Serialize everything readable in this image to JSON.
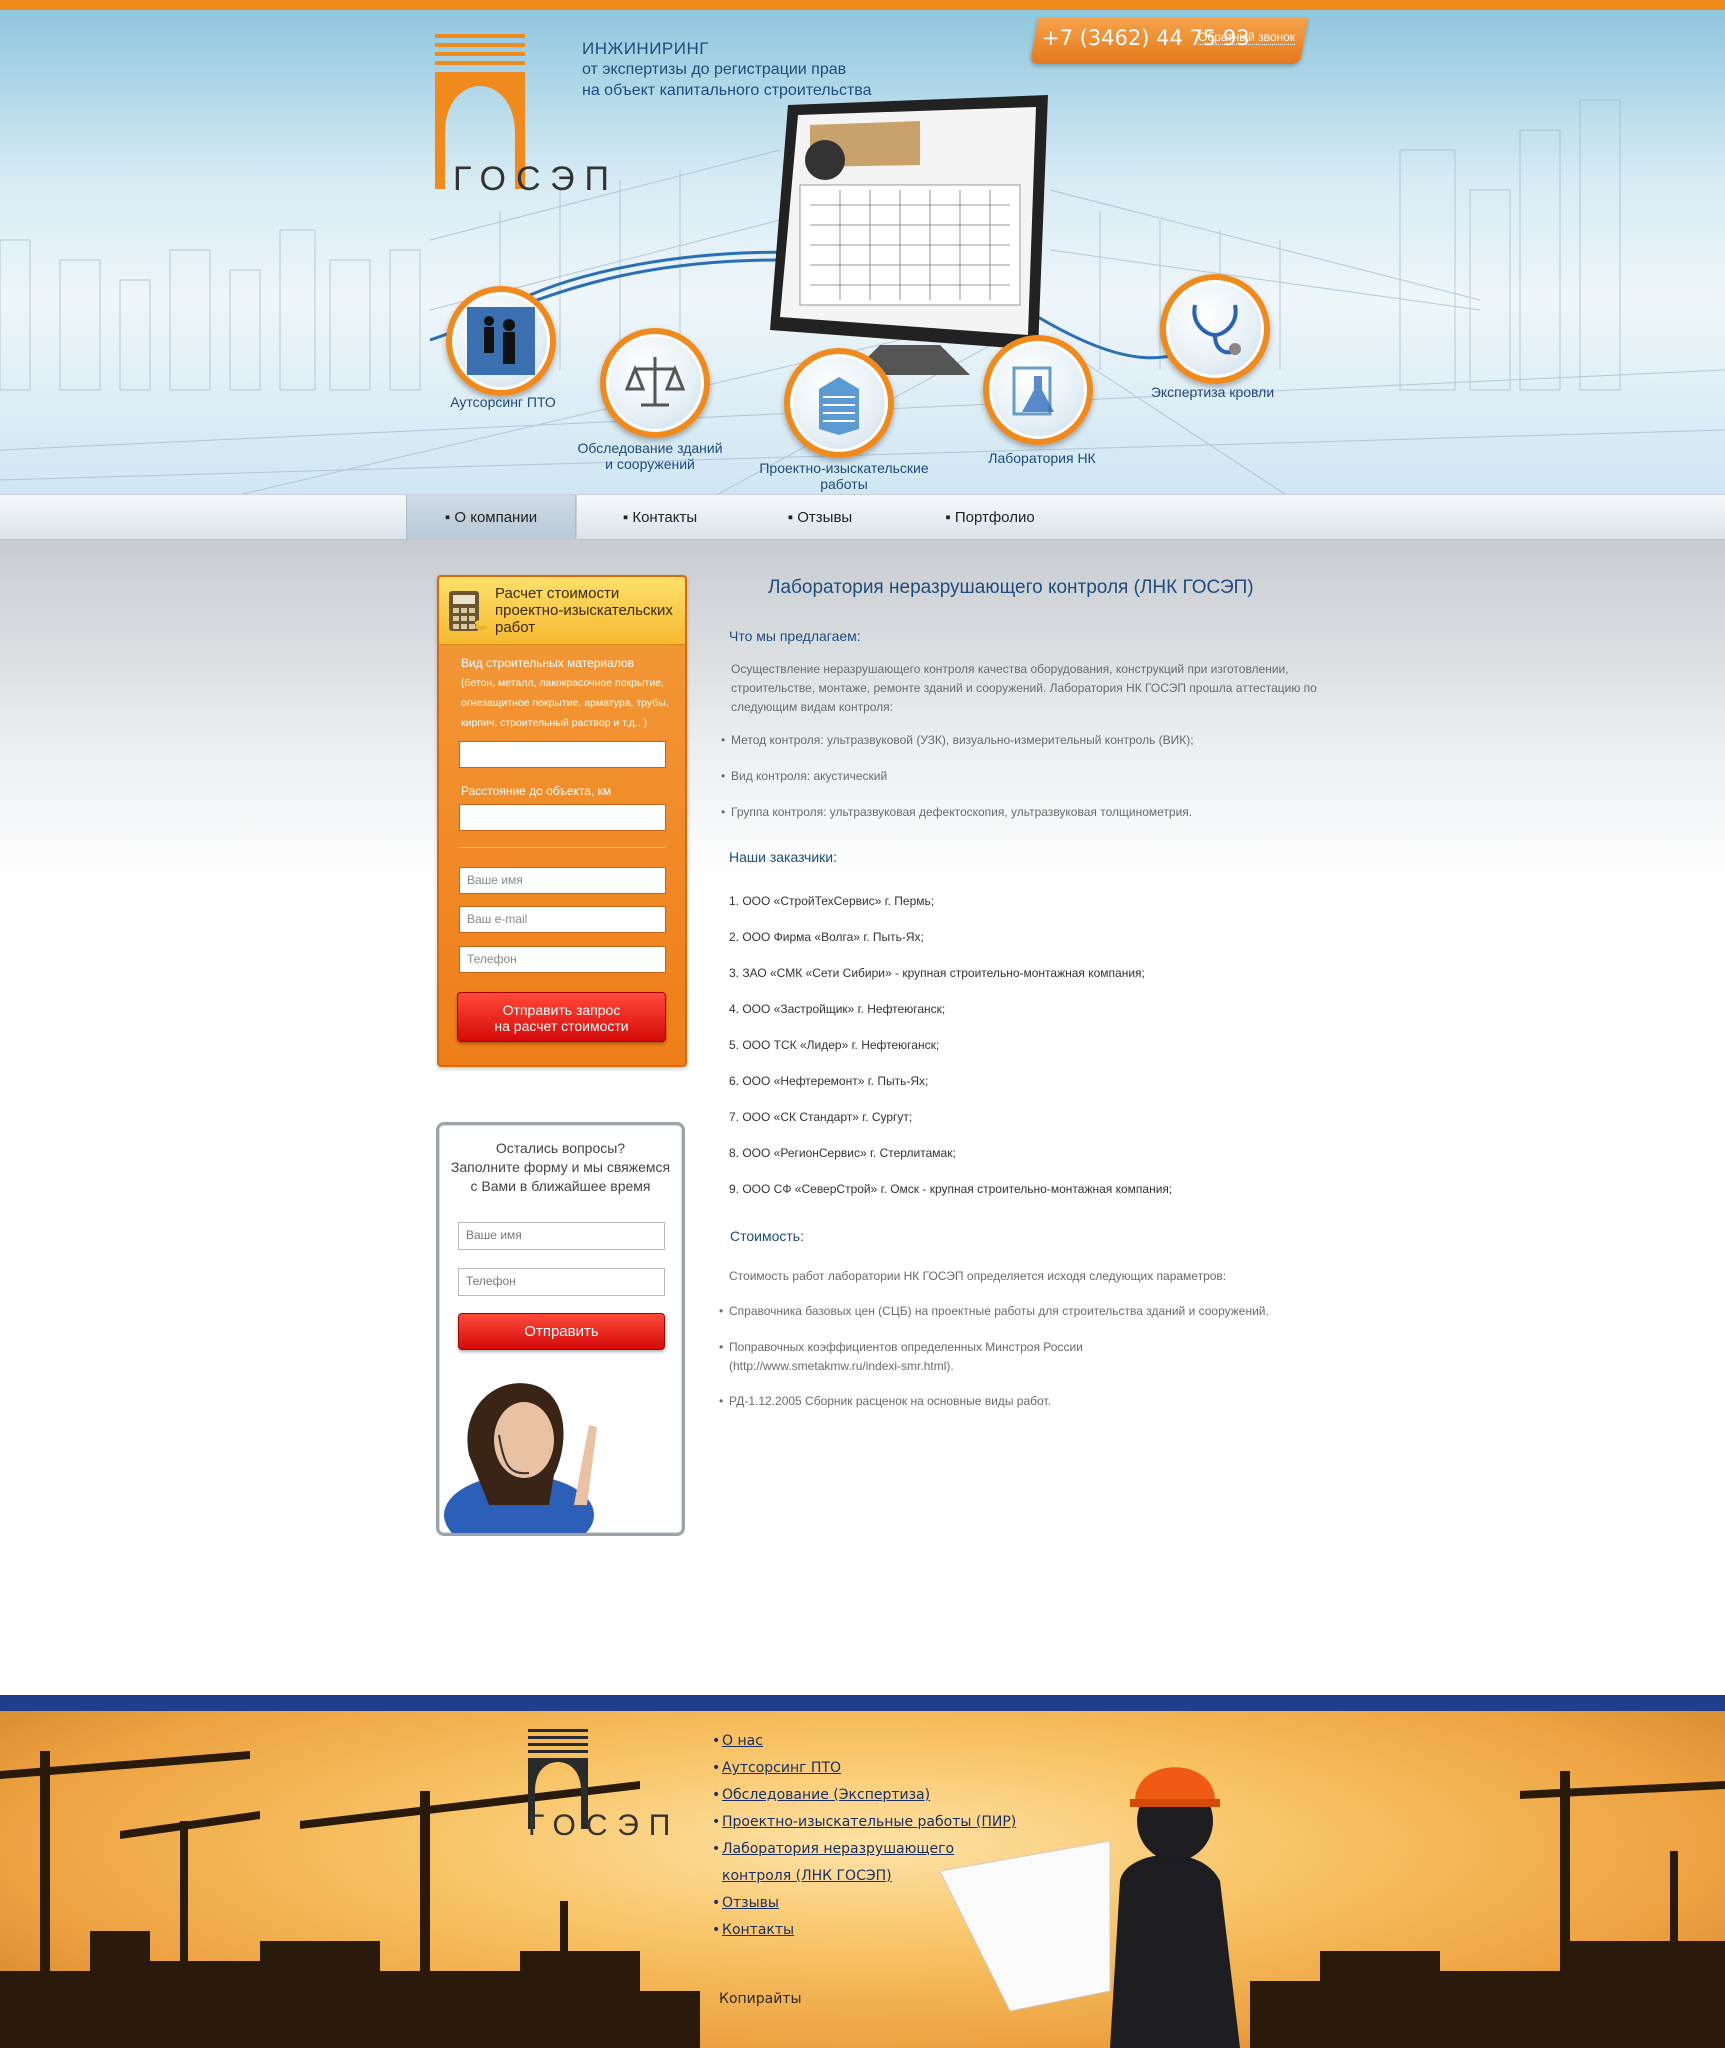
{
  "header": {
    "logo_text": "ГОСЭП",
    "tagline_1": "ИНЖИНИРИНГ",
    "tagline_2": "от экспертизы до регистрации прав",
    "tagline_3": "на объект капитального строительства",
    "phone": "+7 (3462) 44 75 93",
    "callback": "Обратный звонок"
  },
  "services": [
    {
      "label": "Аутсорсинг ПТО",
      "icon": "businessmen-icon"
    },
    {
      "label": "Обследование зданий и сооружений",
      "icon": "scales-icon"
    },
    {
      "label": "Проектно-изыскательские работы",
      "icon": "building-icon"
    },
    {
      "label": "Лаборатория НК",
      "icon": "lab-flask-icon"
    },
    {
      "label": "Экспертиза кровли",
      "icon": "stethoscope-icon"
    }
  ],
  "services_lines": {
    "s2a": "Обследование зданий",
    "s2b": "и сооружений",
    "s3a": "Проектно-изыскательские",
    "s3b": "работы"
  },
  "nav": [
    "О компании",
    "Контакты",
    "Отзывы",
    "Портфолио"
  ],
  "calc": {
    "title": "Расчет стоимости проектно-изыскательских работ",
    "label_material": "Вид строительных материалов",
    "label_material_hint_1": "(бетон, металл, лакокрасочное покрытие,",
    "label_material_hint_2": "огнезащитное покрытие, арматура, трубы,",
    "label_material_hint_3": "кирпич, строительный раствор и т.д.. )",
    "label_distance": "Расстояние до объекта, км",
    "ph_name": "Ваше имя",
    "ph_email": "Ваш e-mail",
    "ph_phone": "Телефон",
    "button_1": "Отправить запрос",
    "button_2": "на расчет стоимости"
  },
  "ask": {
    "line1": "Остались вопросы?",
    "line2": "Заполните форму и мы свяжемся",
    "line3": "с Вами в ближайшее время",
    "ph_name": "Ваше имя",
    "ph_phone": "Телефон",
    "button": "Отправить"
  },
  "content": {
    "title": "Лаборатория неразрушающего контроля (ЛНК ГОСЭП)",
    "offer_heading": "Что мы предлагаем:",
    "offer_p1": "Осуществление неразрушающего контроля качества оборудования, конструкций при изготовлении,",
    "offer_p2": "строительстве, монтаже, ремонте зданий и сооружений. Лаборатория НК ГОСЭП прошла аттестацию по",
    "offer_p3": "следующим видам контроля:",
    "offer_items": [
      "Метод контроля: ультразвуковой (УЗК), визуально-измерительный контроль (ВИК);",
      "Вид контроля: акустический",
      "Группа контроля: ультразвуковая дефектоскопия, ультразвуковая толщинометрия."
    ],
    "customers_heading": "Наши заказчики:",
    "customers": [
      "1. ООО «СтройТехСервис» г. Пермь;",
      "2. ООО Фирма «Волга» г. Пыть-Ях;",
      "3. ЗАО «СМК «Сети Сибири» - крупная строительно-монтажная компания;",
      "4. ООО «Застройщик» г. Нефтеюганск;",
      "5. ООО ТСК «Лидер» г. Нефтеюганск;",
      "6. ООО «Нефтеремонт» г. Пыть-Ях;",
      "7. ООО «СК Стандарт» г. Сургут;",
      "8. ООО «РегионСервис» г. Стерлитамак;",
      "9. ООО СФ «СеверСтрой» г. Омск - крупная строительно-монтажная компания;"
    ],
    "cost_heading": "Стоимость:",
    "cost_p": "Стоимость работ лаборатории НК ГОСЭП определяется исходя следующих параметров:",
    "cost_items": [
      "Справочника базовых цен (СЦБ) на проектные работы для строительства зданий и сооружений.",
      "Поправочных коэффициентов определенных Минстроя России",
      "РД-1.12.2005 Сборник расценок на основные виды работ."
    ],
    "cost_item2_line2": "(http://www.smetakmw.ru/indexi-smr.html)."
  },
  "footer": {
    "logo_text": "ГОСЭП",
    "links": [
      "О нас",
      "Аутсорсинг ПТО",
      "Обследование (Экспертиза)",
      "Проектно-изыскательные работы (ПИР)",
      "Лаборатория неразрушающего",
      "контроля (ЛНК ГОСЭП)",
      "Отзывы",
      "Контакты"
    ],
    "copyright": "Копирайты"
  },
  "colors": {
    "accent_orange": "#f08a1c",
    "heading_blue": "#1e4c7c",
    "button_red": "#e0140c",
    "footer_bar": "#223d8c"
  }
}
